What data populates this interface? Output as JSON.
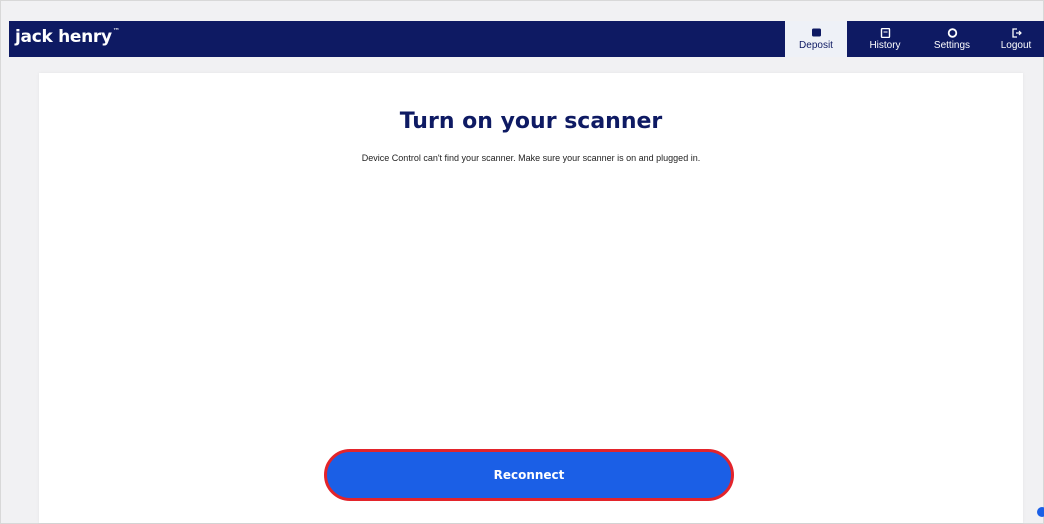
{
  "brand": {
    "logo_text": "jack henry",
    "trademark": "™"
  },
  "nav": {
    "items": [
      {
        "label": "Deposit",
        "icon": "deposit-icon",
        "active": true
      },
      {
        "label": "History",
        "icon": "history-icon",
        "active": false
      },
      {
        "label": "Settings",
        "icon": "settings-icon",
        "active": false
      },
      {
        "label": "Logout",
        "icon": "logout-icon",
        "active": false
      }
    ]
  },
  "main": {
    "title": "Turn on your scanner",
    "message": "Device Control can't find your scanner. Make sure your scanner is on and plugged in.",
    "reconnect_label": "Reconnect"
  },
  "colors": {
    "navbar": "#0e1a63",
    "button": "#1b5fe6",
    "highlight_border": "#e3242b",
    "active_tab": "#eef1f7"
  }
}
